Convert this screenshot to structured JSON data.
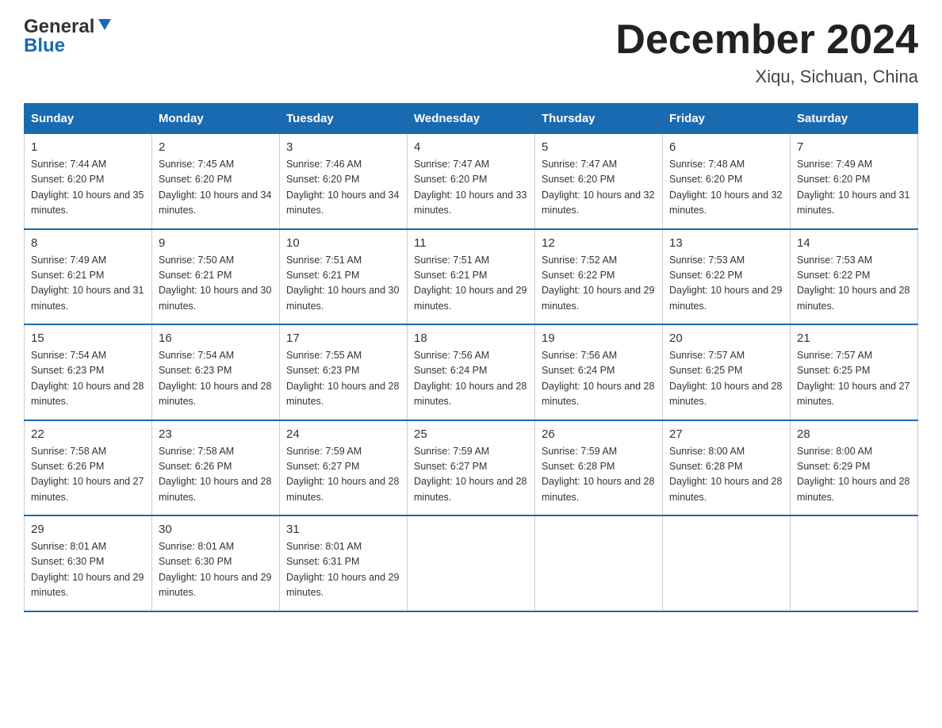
{
  "header": {
    "logo": {
      "line1": "General",
      "line2": "Blue"
    },
    "title": "December 2024",
    "location": "Xiqu, Sichuan, China"
  },
  "days_of_week": [
    "Sunday",
    "Monday",
    "Tuesday",
    "Wednesday",
    "Thursday",
    "Friday",
    "Saturday"
  ],
  "weeks": [
    [
      {
        "day": "1",
        "sunrise": "7:44 AM",
        "sunset": "6:20 PM",
        "daylight": "10 hours and 35 minutes."
      },
      {
        "day": "2",
        "sunrise": "7:45 AM",
        "sunset": "6:20 PM",
        "daylight": "10 hours and 34 minutes."
      },
      {
        "day": "3",
        "sunrise": "7:46 AM",
        "sunset": "6:20 PM",
        "daylight": "10 hours and 34 minutes."
      },
      {
        "day": "4",
        "sunrise": "7:47 AM",
        "sunset": "6:20 PM",
        "daylight": "10 hours and 33 minutes."
      },
      {
        "day": "5",
        "sunrise": "7:47 AM",
        "sunset": "6:20 PM",
        "daylight": "10 hours and 32 minutes."
      },
      {
        "day": "6",
        "sunrise": "7:48 AM",
        "sunset": "6:20 PM",
        "daylight": "10 hours and 32 minutes."
      },
      {
        "day": "7",
        "sunrise": "7:49 AM",
        "sunset": "6:20 PM",
        "daylight": "10 hours and 31 minutes."
      }
    ],
    [
      {
        "day": "8",
        "sunrise": "7:49 AM",
        "sunset": "6:21 PM",
        "daylight": "10 hours and 31 minutes."
      },
      {
        "day": "9",
        "sunrise": "7:50 AM",
        "sunset": "6:21 PM",
        "daylight": "10 hours and 30 minutes."
      },
      {
        "day": "10",
        "sunrise": "7:51 AM",
        "sunset": "6:21 PM",
        "daylight": "10 hours and 30 minutes."
      },
      {
        "day": "11",
        "sunrise": "7:51 AM",
        "sunset": "6:21 PM",
        "daylight": "10 hours and 29 minutes."
      },
      {
        "day": "12",
        "sunrise": "7:52 AM",
        "sunset": "6:22 PM",
        "daylight": "10 hours and 29 minutes."
      },
      {
        "day": "13",
        "sunrise": "7:53 AM",
        "sunset": "6:22 PM",
        "daylight": "10 hours and 29 minutes."
      },
      {
        "day": "14",
        "sunrise": "7:53 AM",
        "sunset": "6:22 PM",
        "daylight": "10 hours and 28 minutes."
      }
    ],
    [
      {
        "day": "15",
        "sunrise": "7:54 AM",
        "sunset": "6:23 PM",
        "daylight": "10 hours and 28 minutes."
      },
      {
        "day": "16",
        "sunrise": "7:54 AM",
        "sunset": "6:23 PM",
        "daylight": "10 hours and 28 minutes."
      },
      {
        "day": "17",
        "sunrise": "7:55 AM",
        "sunset": "6:23 PM",
        "daylight": "10 hours and 28 minutes."
      },
      {
        "day": "18",
        "sunrise": "7:56 AM",
        "sunset": "6:24 PM",
        "daylight": "10 hours and 28 minutes."
      },
      {
        "day": "19",
        "sunrise": "7:56 AM",
        "sunset": "6:24 PM",
        "daylight": "10 hours and 28 minutes."
      },
      {
        "day": "20",
        "sunrise": "7:57 AM",
        "sunset": "6:25 PM",
        "daylight": "10 hours and 28 minutes."
      },
      {
        "day": "21",
        "sunrise": "7:57 AM",
        "sunset": "6:25 PM",
        "daylight": "10 hours and 27 minutes."
      }
    ],
    [
      {
        "day": "22",
        "sunrise": "7:58 AM",
        "sunset": "6:26 PM",
        "daylight": "10 hours and 27 minutes."
      },
      {
        "day": "23",
        "sunrise": "7:58 AM",
        "sunset": "6:26 PM",
        "daylight": "10 hours and 28 minutes."
      },
      {
        "day": "24",
        "sunrise": "7:59 AM",
        "sunset": "6:27 PM",
        "daylight": "10 hours and 28 minutes."
      },
      {
        "day": "25",
        "sunrise": "7:59 AM",
        "sunset": "6:27 PM",
        "daylight": "10 hours and 28 minutes."
      },
      {
        "day": "26",
        "sunrise": "7:59 AM",
        "sunset": "6:28 PM",
        "daylight": "10 hours and 28 minutes."
      },
      {
        "day": "27",
        "sunrise": "8:00 AM",
        "sunset": "6:28 PM",
        "daylight": "10 hours and 28 minutes."
      },
      {
        "day": "28",
        "sunrise": "8:00 AM",
        "sunset": "6:29 PM",
        "daylight": "10 hours and 28 minutes."
      }
    ],
    [
      {
        "day": "29",
        "sunrise": "8:01 AM",
        "sunset": "6:30 PM",
        "daylight": "10 hours and 29 minutes."
      },
      {
        "day": "30",
        "sunrise": "8:01 AM",
        "sunset": "6:30 PM",
        "daylight": "10 hours and 29 minutes."
      },
      {
        "day": "31",
        "sunrise": "8:01 AM",
        "sunset": "6:31 PM",
        "daylight": "10 hours and 29 minutes."
      },
      null,
      null,
      null,
      null
    ]
  ],
  "labels": {
    "sunrise": "Sunrise:",
    "sunset": "Sunset:",
    "daylight": "Daylight:"
  }
}
